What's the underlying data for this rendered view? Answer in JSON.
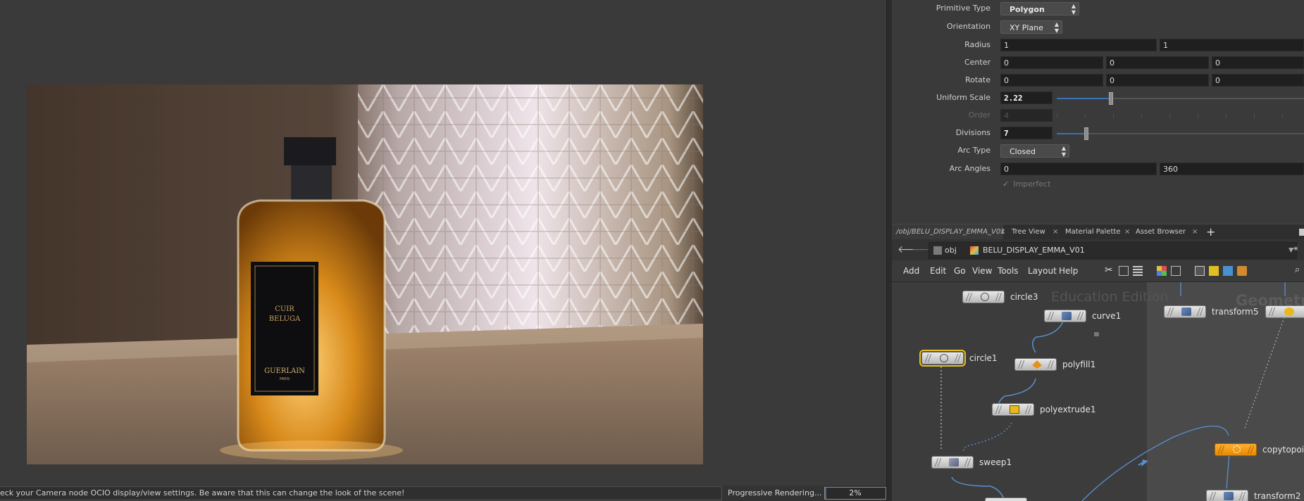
{
  "status": {
    "message": "eck your Camera node OCIO display/view settings. Be aware that this can change the look of the scene!",
    "progress_label": "Progressive Rendering...",
    "progress_value": "2%",
    "progress_fraction": 0.02
  },
  "render": {
    "bottle_label_line1": "CUIR",
    "bottle_label_line2": "BELUGA",
    "bottle_brand": "GUERLAIN",
    "bottle_city": "PARIS"
  },
  "params": {
    "primitive_type": {
      "label": "Primitive Type",
      "value": "Polygon"
    },
    "orientation": {
      "label": "Orientation",
      "value": "XY Plane"
    },
    "radius": {
      "label": "Radius",
      "v1": "1",
      "v2": "1"
    },
    "center": {
      "label": "Center",
      "v1": "0",
      "v2": "0",
      "v3": "0"
    },
    "rotate": {
      "label": "Rotate",
      "v1": "0",
      "v2": "0",
      "v3": "0"
    },
    "uniform_scale": {
      "label": "Uniform Scale",
      "value": "2.22",
      "slider_fraction": 0.22
    },
    "order": {
      "label": "Order",
      "value": "4"
    },
    "divisions": {
      "label": "Divisions",
      "value": "7",
      "slider_fraction": 0.12
    },
    "arc_type": {
      "label": "Arc Type",
      "value": "Closed"
    },
    "arc_angles": {
      "label": "Arc Angles",
      "v1": "0",
      "v2": "360"
    },
    "imperfect": {
      "label": "Imperfect"
    }
  },
  "tabs": [
    {
      "label": "/obj/BELU_DISPLAY_EMMA_V01",
      "close": "×"
    },
    {
      "label": "Tree View",
      "close": "×"
    },
    {
      "label": "Material Palette",
      "close": "×"
    },
    {
      "label": "Asset Browser",
      "close": "×"
    }
  ],
  "tab_add": "+",
  "path": {
    "root": "obj",
    "current": "BELU_DISPLAY_EMMA_V01"
  },
  "menu": [
    "Add",
    "Edit",
    "Go",
    "View",
    "Tools",
    "Layout",
    "Help"
  ],
  "network": {
    "watermark": "Education Edition",
    "box_title": "Geometr",
    "nodes": {
      "circle3": "circle3",
      "curve1": "curve1",
      "circle1": "circle1",
      "polyfill1": "polyfill1",
      "polyextrude1": "polyextrude1",
      "sweep1": "sweep1",
      "transform5": "transform5",
      "copytopoints": "copytopoin",
      "transform2": "transform2"
    }
  },
  "colors": {
    "accent_blue": "#3d6fb5",
    "selected_outline": "#e8c21a",
    "node_orange": "#f0a020"
  }
}
